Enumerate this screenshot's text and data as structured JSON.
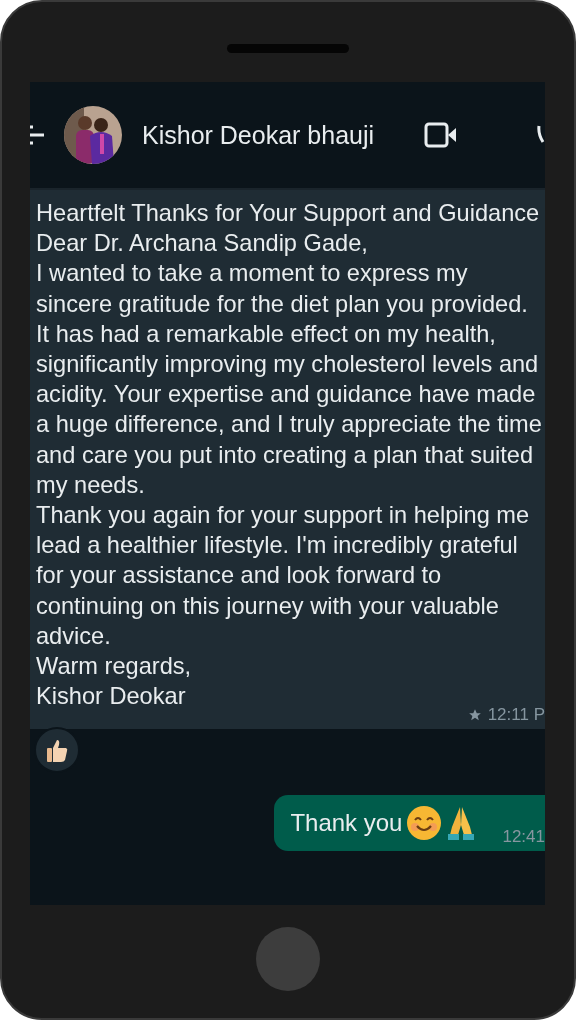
{
  "chat": {
    "contact_name": "Kishor Deokar bhauji"
  },
  "messages": [
    {
      "kind": "incoming",
      "paragraphs": [
        "Heartfelt Thanks for Your Support and Guidance",
        "Dear Dr. Archana Sandip Gade,",
        "I wanted to take a moment to express my sincere gratitude for the diet plan you provided. It has had a remarkable effect on my health, significantly improving my cholesterol levels and acidity. Your expertise and guidance have made a huge difference, and I truly appreciate the time and care you put into creating a plan that suited my needs.",
        "Thank you again for your support in helping me lead a healthier lifestyle. I'm incredibly grateful for your assistance and look forward to continuing on this journey with your valuable advice.",
        "Warm regards,",
        "Kishor Deokar"
      ],
      "time": "12:11 P",
      "starred": true,
      "reaction": {
        "kind": "thumbs-up"
      }
    },
    {
      "kind": "outgoing",
      "paragraphs": [
        "Thank you"
      ],
      "emojis": [
        {
          "kind": "smile"
        },
        {
          "kind": "folded-hands"
        }
      ],
      "time": "12:41"
    }
  ]
}
